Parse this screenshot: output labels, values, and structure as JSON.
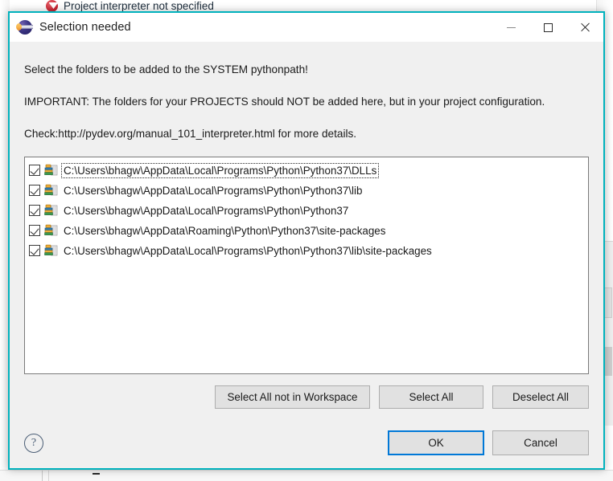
{
  "background": {
    "error_text": "Project interpreter not specified",
    "error_icon": "error-circle-icon"
  },
  "dialog": {
    "title": "Selection needed",
    "title_icon": "eclipse-sphere-icon",
    "accent_color": "#00b2bd",
    "window_controls": {
      "minimize": "minimize-icon",
      "maximize": "maximize-icon",
      "close": "close-icon"
    },
    "messages": {
      "line1": "Select the folders to be added to the SYSTEM pythonpath!",
      "line2": "IMPORTANT: The folders for your PROJECTS should NOT be added here, but in your project configuration.",
      "line3": "Check:http://pydev.org/manual_101_interpreter.html for more details."
    },
    "list": {
      "item_icon": "library-folder-icon",
      "items": [
        {
          "label": "C:\\Users\\bhagw\\AppData\\Local\\Programs\\Python\\Python37\\DLLs",
          "checked": true,
          "focused": true
        },
        {
          "label": "C:\\Users\\bhagw\\AppData\\Local\\Programs\\Python\\Python37\\lib",
          "checked": true,
          "focused": false
        },
        {
          "label": "C:\\Users\\bhagw\\AppData\\Local\\Programs\\Python\\Python37",
          "checked": true,
          "focused": false
        },
        {
          "label": "C:\\Users\\bhagw\\AppData\\Roaming\\Python\\Python37\\site-packages",
          "checked": true,
          "focused": false
        },
        {
          "label": "C:\\Users\\bhagw\\AppData\\Local\\Programs\\Python\\Python37\\lib\\site-packages",
          "checked": true,
          "focused": false
        }
      ]
    },
    "selection_buttons": {
      "select_all_not_in_workspace": "Select All not in Workspace",
      "select_all": "Select All",
      "deselect_all": "Deselect All"
    },
    "footer": {
      "help_glyph": "?",
      "ok": "OK",
      "cancel": "Cancel",
      "focus_color": "#0078d7"
    }
  }
}
